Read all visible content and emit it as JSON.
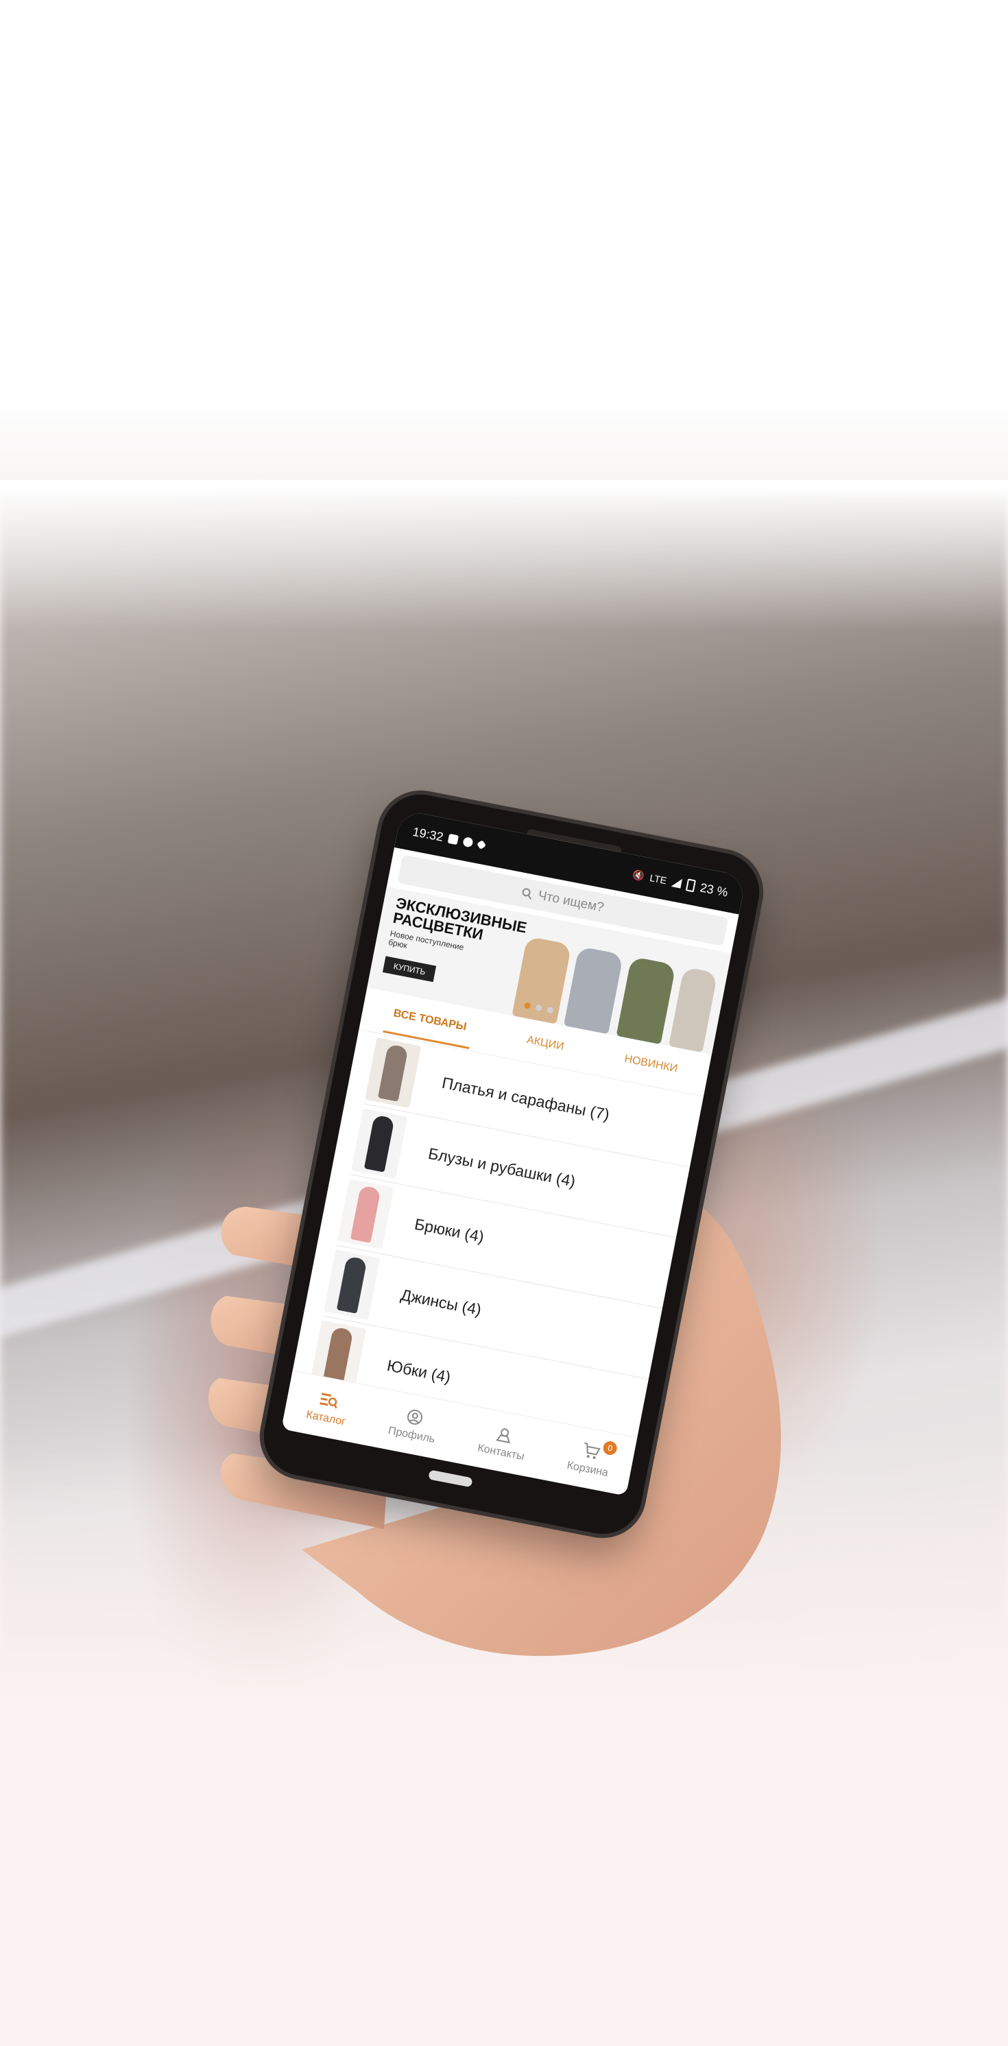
{
  "status_bar": {
    "time": "19:32",
    "network": "LTE",
    "battery": "23 %"
  },
  "search": {
    "placeholder": "Что ищем?"
  },
  "banner": {
    "title": "ЭКСКЛЮЗИВНЫЕ РАСЦВЕТКИ",
    "subtitle": "Новое поступление брюк",
    "button_label": "КУПИТЬ",
    "slides_count": 3,
    "active_slide": 1
  },
  "tabs": [
    {
      "label": "ВСЕ ТОВАРЫ",
      "active": true
    },
    {
      "label": "АКЦИИ",
      "active": false
    },
    {
      "label": "НОВИНКИ",
      "active": false
    }
  ],
  "categories": [
    {
      "label": "Платья и сарафаны (7)",
      "thumb_color": "#8a7a70"
    },
    {
      "label": "Блузы и рубашки (4)",
      "thumb_color": "#2a2a2e"
    },
    {
      "label": "Брюки (4)",
      "thumb_color": "#e6a1a1"
    },
    {
      "label": "Джинсы (4)",
      "thumb_color": "#3a3d42"
    },
    {
      "label": "Юбки (4)",
      "thumb_color": "#9a7560"
    }
  ],
  "bottom_nav": [
    {
      "label": "Каталог",
      "icon": "catalog-icon",
      "active": true
    },
    {
      "label": "Профиль",
      "icon": "profile-icon",
      "active": false
    },
    {
      "label": "Контакты",
      "icon": "location-icon",
      "active": false
    },
    {
      "label": "Корзина",
      "icon": "cart-icon",
      "active": false,
      "badge": "0"
    }
  ],
  "colors": {
    "accent": "#e08a2e",
    "accent_text": "#d58a33",
    "background": "#fbf2f1"
  }
}
